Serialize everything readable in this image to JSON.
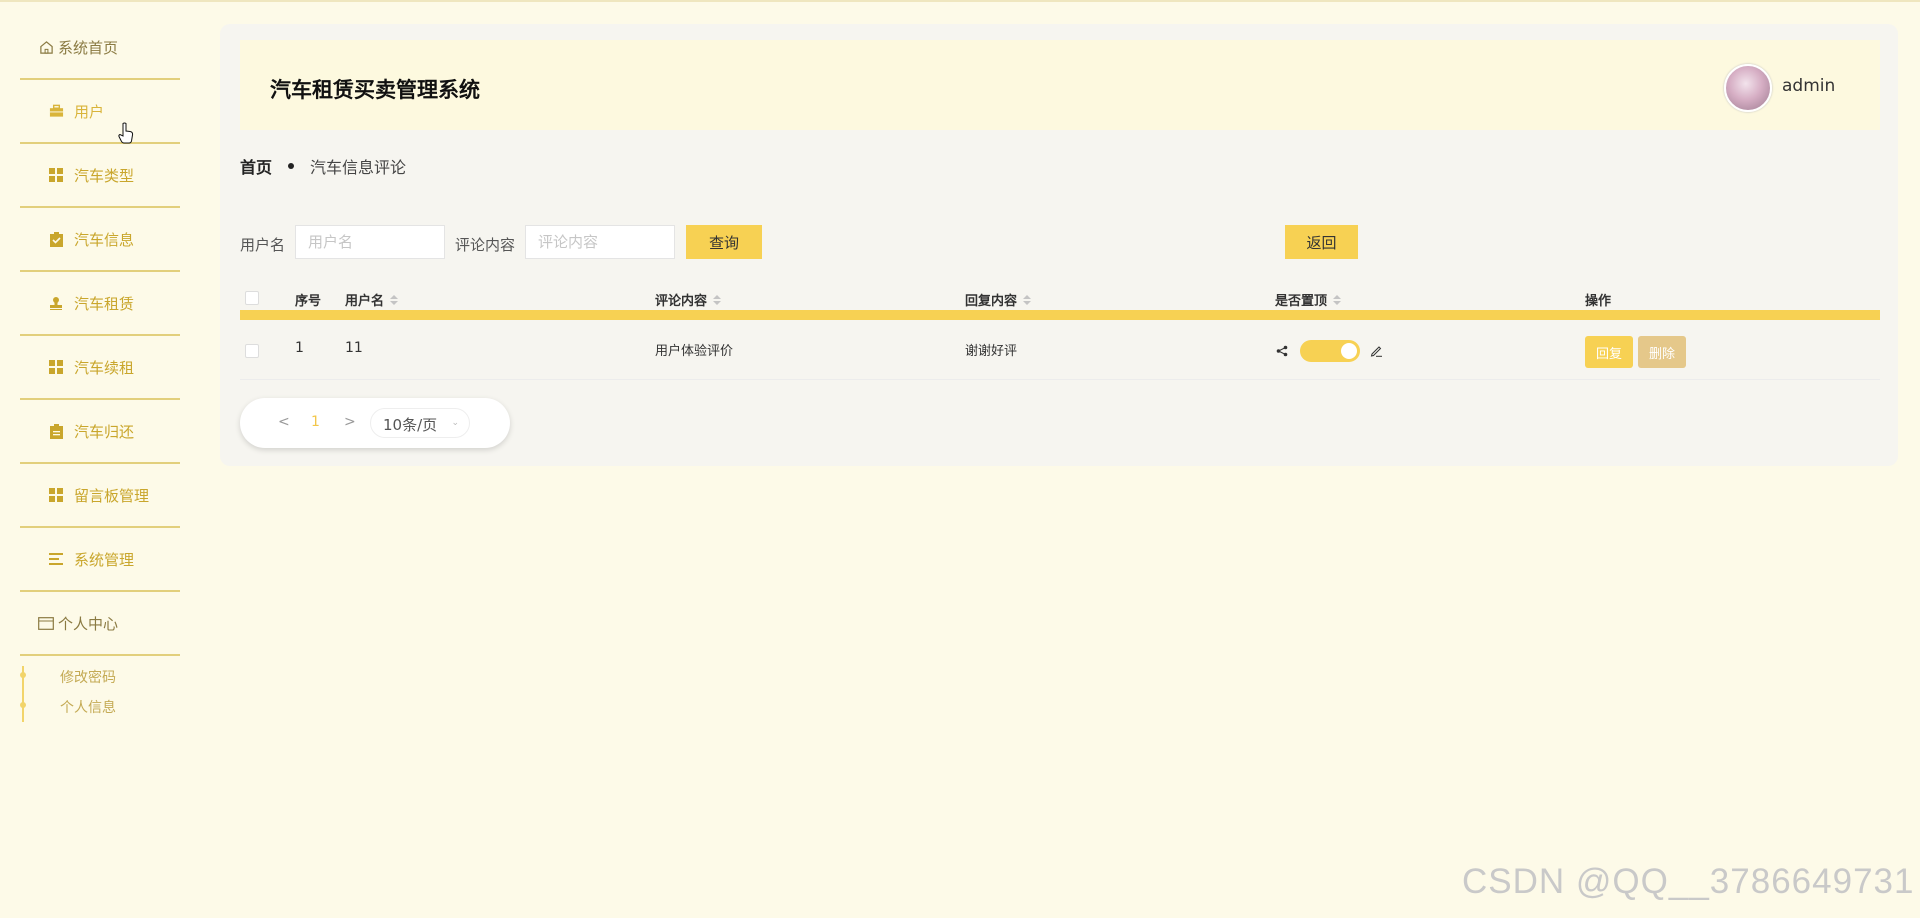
{
  "sidebar": {
    "home": {
      "label": "系统首页",
      "icon": "home-icon"
    },
    "items": [
      {
        "label": "用户",
        "icon": "briefcase-icon"
      },
      {
        "label": "汽车类型",
        "icon": "grid-icon"
      },
      {
        "label": "汽车信息",
        "icon": "clipboard-check-icon"
      },
      {
        "label": "汽车租赁",
        "icon": "stamp-icon"
      },
      {
        "label": "汽车续租",
        "icon": "grid-icon"
      },
      {
        "label": "汽车归还",
        "icon": "clipboard-icon"
      },
      {
        "label": "留言板管理",
        "icon": "grid-icon"
      },
      {
        "label": "系统管理",
        "icon": "menu-lines-icon"
      }
    ],
    "profile": {
      "label": "个人中心",
      "icon": "card-icon"
    },
    "sub_items": [
      "修改密码",
      "个人信息"
    ]
  },
  "header": {
    "title": "汽车租赁买卖管理系统",
    "username": "admin"
  },
  "breadcrumb": {
    "home": "首页",
    "current": "汽车信息评论"
  },
  "search": {
    "username_label": "用户名",
    "username_placeholder": "用户名",
    "content_label": "评论内容",
    "content_placeholder": "评论内容",
    "query_button": "查询",
    "back_button": "返回"
  },
  "table": {
    "headers": {
      "index": "序号",
      "username": "用户名",
      "content": "评论内容",
      "reply": "回复内容",
      "pinned": "是否置顶",
      "actions": "操作"
    },
    "rows": [
      {
        "index": "1",
        "username": "11",
        "content": "用户体验评价",
        "reply": "谢谢好评",
        "pinned": true,
        "reply_btn": "回复",
        "delete_btn": "删除"
      }
    ]
  },
  "pagination": {
    "prev": "<",
    "page": "1",
    "next": ">",
    "page_size": "10条/页"
  },
  "colors": {
    "accent": "#f7d153",
    "background": "#fdfae8",
    "delete_button": "#e5c88a"
  },
  "watermark": "CSDN @QQ__3786649731"
}
